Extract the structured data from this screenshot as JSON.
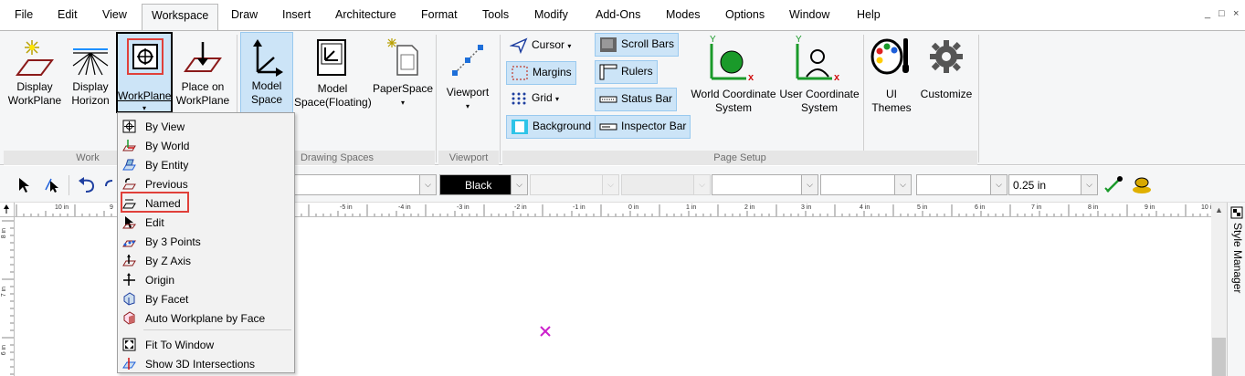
{
  "menubar": {
    "items": [
      "File",
      "Edit",
      "View",
      "Workspace",
      "Draw",
      "Insert",
      "Architecture",
      "Format",
      "Tools",
      "Modify",
      "Add-Ons",
      "Modes",
      "Options",
      "Window",
      "Help"
    ],
    "active": "Workspace",
    "window_controls": [
      "_",
      "□",
      "×"
    ]
  },
  "ribbon": {
    "workplane_group": {
      "display_workplane": "Display\nWorkPlane",
      "display_horizon": "Display\nHorizon",
      "workplane": "WorkPlane",
      "place_on_workplane": "Place on\nWorkPlane",
      "label": "Work"
    },
    "drawing_spaces": {
      "model_space": "Model\nSpace",
      "model_space_floating": "Model\nSpace(Floating)",
      "paper_space": "PaperSpace",
      "label": "Drawing Spaces"
    },
    "viewport": {
      "viewport_button": "Viewport",
      "label": "Viewport"
    },
    "page_setup": {
      "cursor": "Cursor",
      "margins": "Margins",
      "grid": "Grid",
      "background": "Background",
      "scroll_bars": "Scroll Bars",
      "rulers": "Rulers",
      "status_bar": "Status Bar",
      "inspector_bar": "Inspector Bar",
      "world_coordinate_system": "World Coordinate\nSystem",
      "user_coordinate_system": "User Coordinate\nSystem",
      "ui_themes": "UI\nThemes",
      "customize": "Customize",
      "label": "Page Setup"
    }
  },
  "toolbar": {
    "color_value": "Black",
    "line_width_value": "0.25 in"
  },
  "ruler": {
    "h_labels": [
      "10 in",
      "9",
      "-5 in",
      "-4 in",
      "-3 in",
      "-2 in",
      "-1 in",
      "0 in",
      "1 in",
      "2 in",
      "3 in",
      "4 in",
      "5 in",
      "6 in",
      "7 in",
      "8 in",
      "9 in",
      "10 in"
    ],
    "v_labels": [
      "8 in",
      "7 in",
      "6 in"
    ]
  },
  "side_panel": {
    "label": "Style Manager"
  },
  "dropdown": {
    "items": [
      "By View",
      "By World",
      "By Entity",
      "Previous",
      "Named",
      "Edit",
      "By 3 Points",
      "By Z Axis",
      "Origin",
      "By Facet",
      "Auto Workplane by Face",
      "Fit To Window",
      "Show 3D Intersections"
    ],
    "highlighted": "Named"
  },
  "colors": {
    "accent_selected": "#cce4f7",
    "highlight_box": "#e0403a",
    "cursor_marker": "#cc22cc"
  }
}
